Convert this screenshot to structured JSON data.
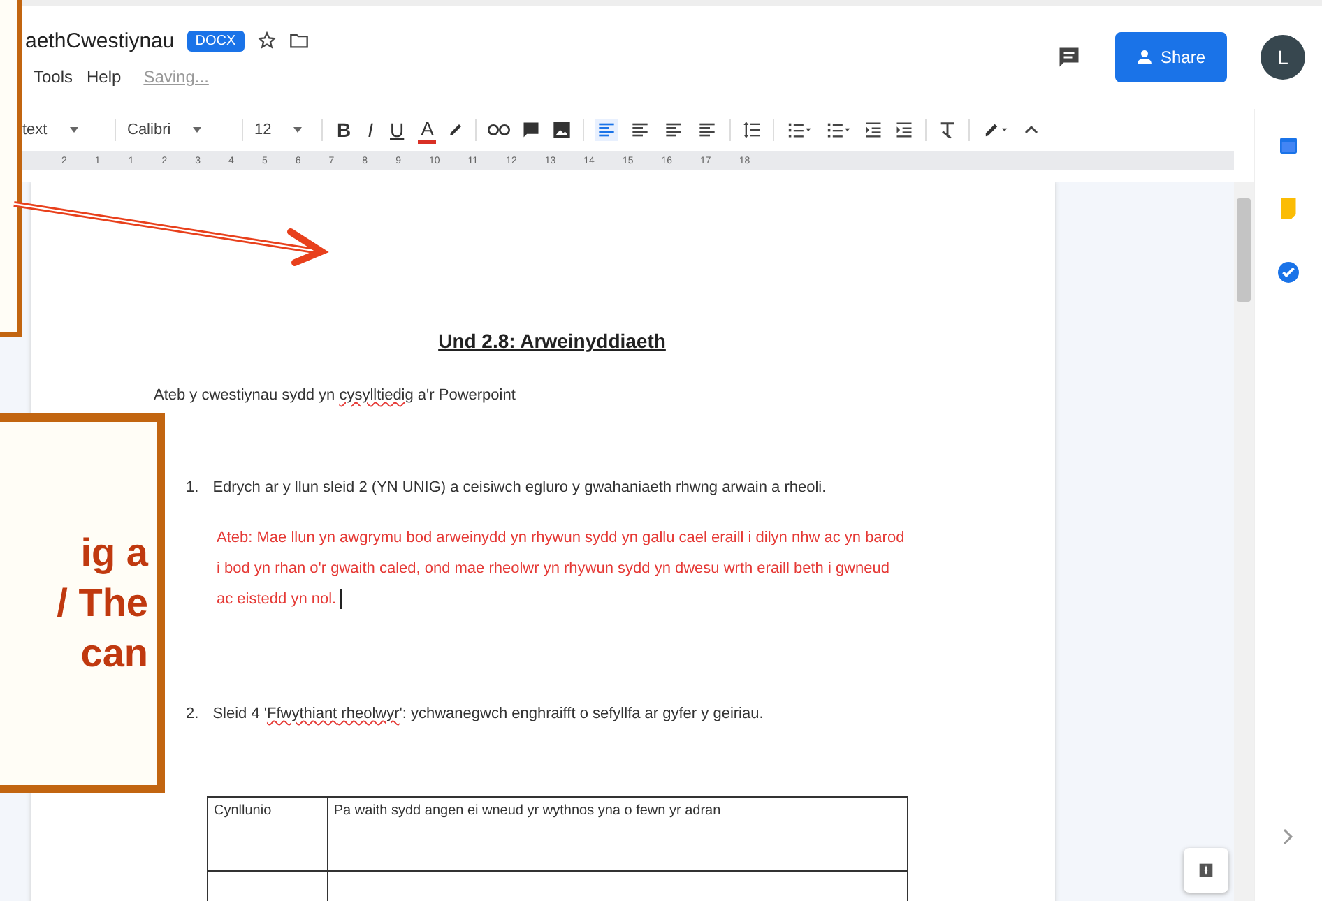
{
  "header": {
    "title": "aethCwestiynau",
    "badge": "DOCX",
    "menu": [
      "Tools",
      "Help"
    ],
    "status": "Saving...",
    "share": "Share",
    "avatar": "L"
  },
  "toolbar": {
    "style": "text",
    "font": "Calibri",
    "size": "12",
    "format": [
      "B",
      "I",
      "U",
      "A"
    ]
  },
  "ruler": [
    "2",
    "1",
    "1",
    "2",
    "3",
    "4",
    "5",
    "6",
    "7",
    "8",
    "9",
    "10",
    "11",
    "12",
    "13",
    "14",
    "15",
    "16",
    "17",
    "18"
  ],
  "document": {
    "heading": "Und 2.8: Arweinyddiaeth",
    "intro": [
      {
        "text": "Ateb y cwestiynau sydd yn ",
        "misspelled": false
      },
      {
        "text": "cysylltiedig",
        "misspelled": true
      },
      {
        "text": " a'r Powerpoint",
        "misspelled": false
      }
    ],
    "questions": [
      {
        "number": "1.",
        "text": [
          {
            "text": "Edrych ar y llun sleid 2 (YN UNIG) a ceisiwch egluro y gwahaniaeth rhwng arwain a rheoli.",
            "misspelled": false
          }
        ],
        "answer": "Ateb: Mae llun yn awgrymu bod arweinydd yn rhywun sydd yn gallu cael eraill i dilyn nhw ac yn barod i bod yn rhan o'r gwaith caled, ond mae rheolwr yn rhywun sydd yn dwesu wrth eraill beth i gwneud ac eistedd yn nol."
      },
      {
        "number": "2.",
        "text": [
          {
            "text": "Sleid 4 '",
            "misspelled": false
          },
          {
            "text": "Ffwythiant",
            "misspelled": true
          },
          {
            "text": " rheolwyr",
            "misspelled": true
          },
          {
            "text": "': ychwanegwch enghraifft o sefyllfa ar gyfer y geiriau.",
            "misspelled": false
          }
        ]
      }
    ],
    "table": [
      [
        "Cynllunio",
        "Pa waith sydd angen ei wneud yr wythnos yna o fewn yr adran"
      ]
    ]
  },
  "callout": {
    "lines": [
      "ig a",
      "/ The",
      "can"
    ]
  }
}
